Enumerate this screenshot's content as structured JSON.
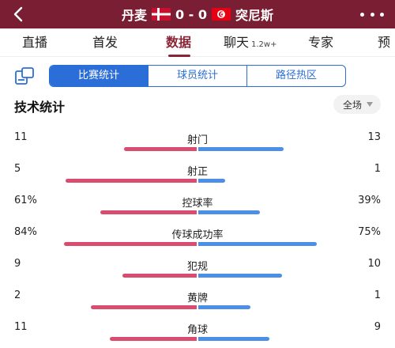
{
  "header": {
    "team_home": "丹麦",
    "score": "0 - 0",
    "team_away": "突尼斯"
  },
  "tabs": [
    {
      "label": "直播"
    },
    {
      "label": "首发"
    },
    {
      "label": "数据"
    },
    {
      "label": "聊天",
      "sub": "1.2w+"
    },
    {
      "label": "专家"
    },
    {
      "label": "预"
    }
  ],
  "segments": [
    "比赛统计",
    "球员统计",
    "路径热区"
  ],
  "section_title": "技术统计",
  "period": "全场",
  "colors": {
    "header_bg": "#7a1f33",
    "home_bar": "#d94c6e",
    "away_bar": "#4d8ee8",
    "accent": "#2b6ed8"
  },
  "icons": [
    "back-arrow-icon",
    "denmark-flag-icon",
    "tunisia-flag-icon",
    "more-dots-icon",
    "filter-layout-icon",
    "caret-down-icon"
  ],
  "stats": [
    {
      "label": "射门",
      "home": "11",
      "away": "13",
      "home_pct": 0.46,
      "away_pct": 0.54
    },
    {
      "label": "射正",
      "home": "5",
      "away": "1",
      "home_pct": 0.83,
      "away_pct": 0.17
    },
    {
      "label": "控球率",
      "home": "61%",
      "away": "39%",
      "home_pct": 0.61,
      "away_pct": 0.39
    },
    {
      "label": "传球成功率",
      "home": "84%",
      "away": "75%",
      "home_pct": 0.84,
      "away_pct": 0.75
    },
    {
      "label": "犯规",
      "home": "9",
      "away": "10",
      "home_pct": 0.47,
      "away_pct": 0.53
    },
    {
      "label": "黄牌",
      "home": "2",
      "away": "1",
      "home_pct": 0.67,
      "away_pct": 0.33
    },
    {
      "label": "角球",
      "home": "11",
      "away": "9",
      "home_pct": 0.55,
      "away_pct": 0.45
    }
  ]
}
